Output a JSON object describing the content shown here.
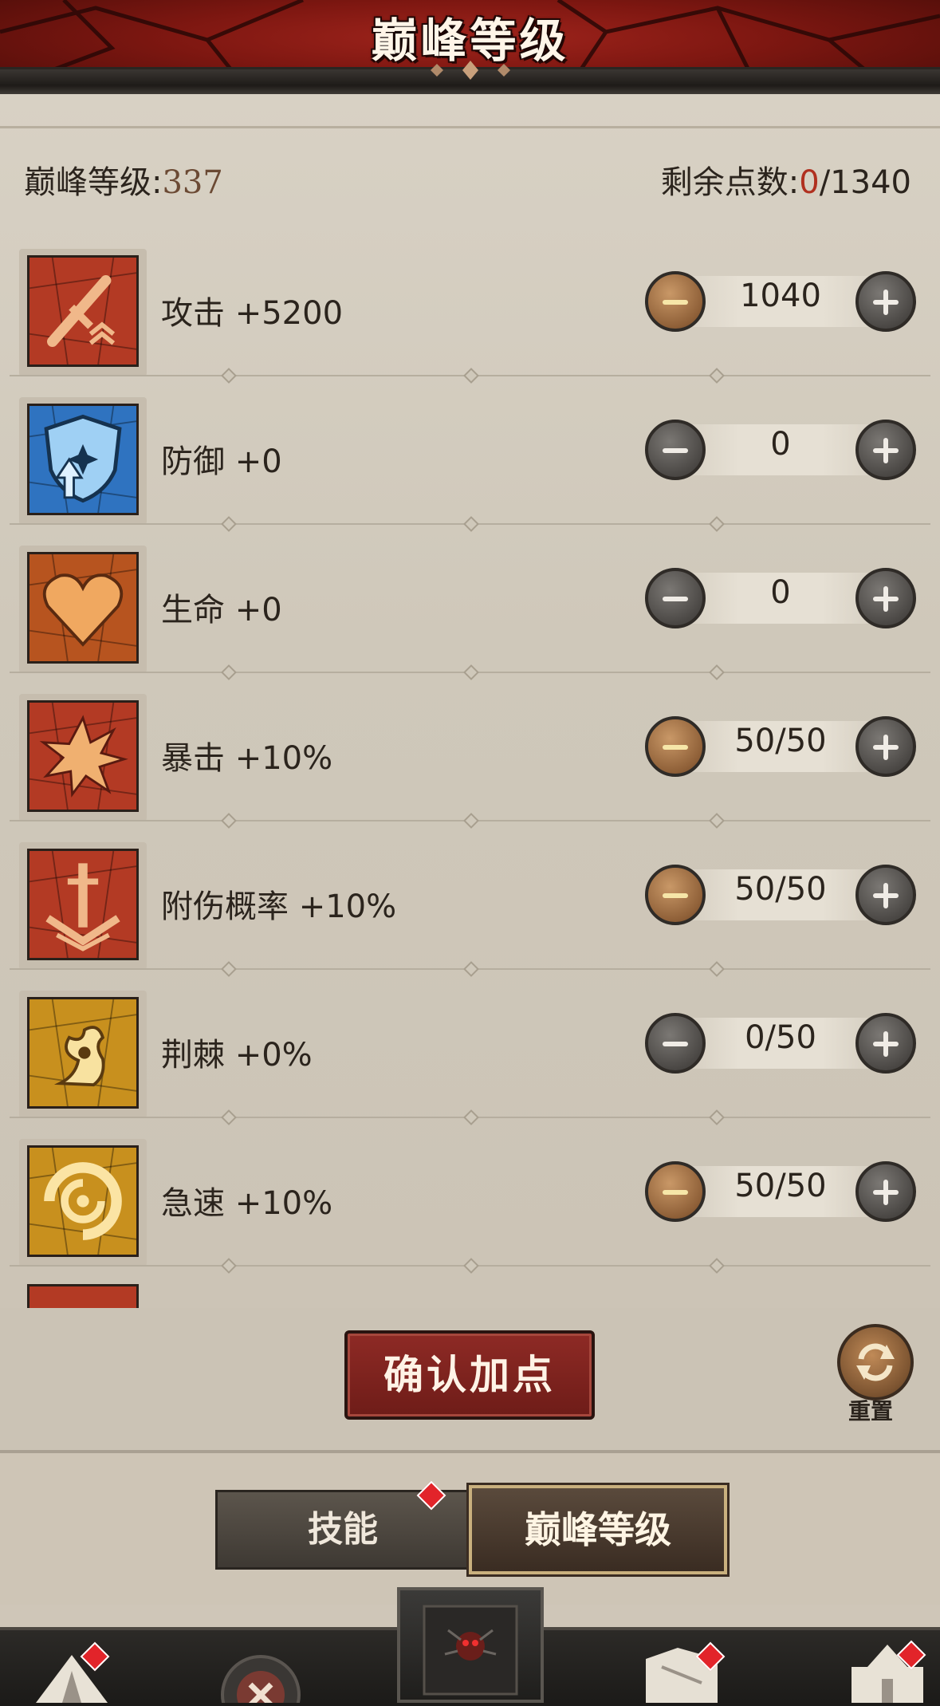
{
  "header": {
    "title": "巅峰等级"
  },
  "summary": {
    "level_label": "巅峰等级:",
    "level_value": "337",
    "points_label": "剩余点数:",
    "points_used": "0",
    "points_total": "/1340"
  },
  "stats": [
    {
      "name": "攻击",
      "bonus": "+5200",
      "value": "1040",
      "minus_style": "bronze",
      "plus_style": "gray",
      "icon": "sword-icon",
      "color": "#b33a24"
    },
    {
      "name": "防御",
      "bonus": "+0",
      "value": "0",
      "minus_style": "gray",
      "plus_style": "gray",
      "icon": "shield-icon",
      "color": "#2f73c0"
    },
    {
      "name": "生命",
      "bonus": "+0",
      "value": "0",
      "minus_style": "gray",
      "plus_style": "gray",
      "icon": "heart-icon",
      "color": "#b7541f"
    },
    {
      "name": "暴击",
      "bonus": "+10%",
      "value": "50/50",
      "minus_style": "bronze",
      "plus_style": "gray",
      "icon": "burst-icon",
      "color": "#b33a24"
    },
    {
      "name": "附伤概率",
      "bonus": "+10%",
      "value": "50/50",
      "minus_style": "bronze",
      "plus_style": "gray",
      "icon": "sword-strike-icon",
      "color": "#b33a24"
    },
    {
      "name": "荆棘",
      "bonus": "+0%",
      "value": "0/50",
      "minus_style": "gray",
      "plus_style": "gray",
      "icon": "thorn-icon",
      "color": "#c8901e"
    },
    {
      "name": "急速",
      "bonus": "+10%",
      "value": "50/50",
      "minus_style": "bronze",
      "plus_style": "gray",
      "icon": "swirl-icon",
      "color": "#c8901e"
    }
  ],
  "actions": {
    "confirm_label": "确认加点",
    "reset_label": "重置"
  },
  "tabs": {
    "skill_label": "技能",
    "peak_label": "巅峰等级"
  },
  "nav": [
    "camp-icon",
    "battle-icon",
    "gate-icon",
    "map-icon",
    "castle-icon"
  ]
}
